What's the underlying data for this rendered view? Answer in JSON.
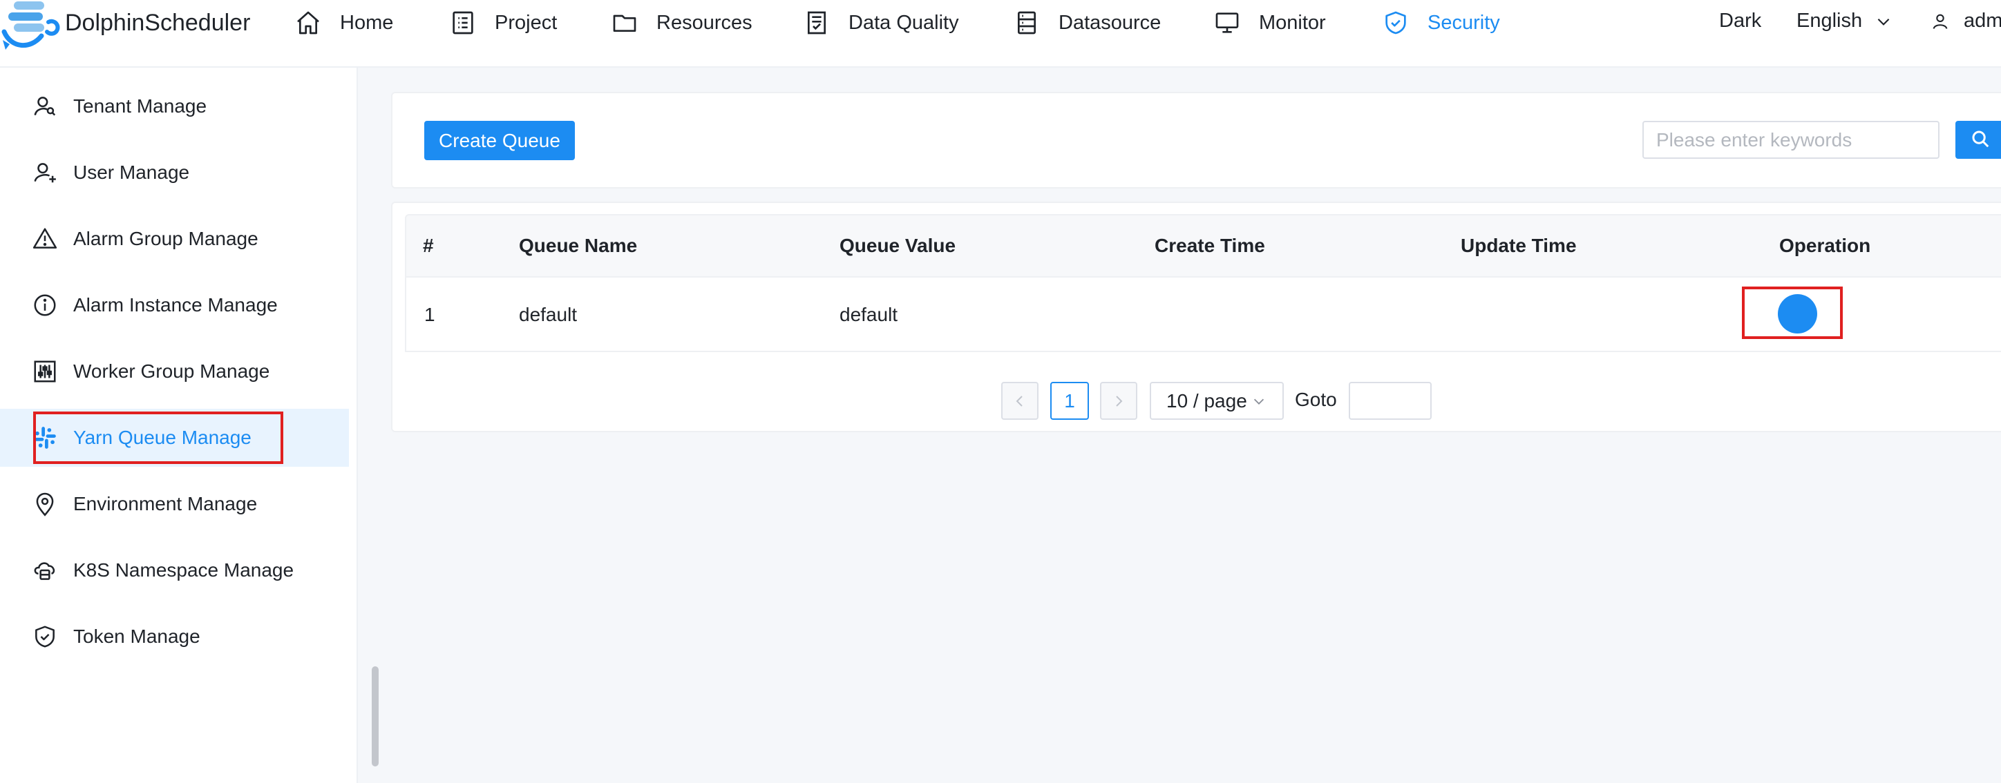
{
  "header": {
    "brand": "DolphinScheduler",
    "nav": [
      {
        "label": "Home",
        "icon": "home-icon"
      },
      {
        "label": "Project",
        "icon": "project-icon"
      },
      {
        "label": "Resources",
        "icon": "folder-icon"
      },
      {
        "label": "Data Quality",
        "icon": "data-quality-icon"
      },
      {
        "label": "Datasource",
        "icon": "datasource-icon"
      },
      {
        "label": "Monitor",
        "icon": "monitor-icon"
      },
      {
        "label": "Security",
        "icon": "shield-icon",
        "active": true
      }
    ],
    "theme_label": "Dark",
    "language_label": "English",
    "user_label": "adm"
  },
  "sidebar": {
    "items": [
      {
        "label": "Tenant Manage",
        "icon": "tenant-icon"
      },
      {
        "label": "User Manage",
        "icon": "user-add-icon"
      },
      {
        "label": "Alarm Group Manage",
        "icon": "warning-icon"
      },
      {
        "label": "Alarm Instance Manage",
        "icon": "info-icon"
      },
      {
        "label": "Worker Group Manage",
        "icon": "sliders-icon"
      },
      {
        "label": "Yarn Queue Manage",
        "icon": "slack-icon",
        "active": true
      },
      {
        "label": "Environment Manage",
        "icon": "location-icon"
      },
      {
        "label": "K8S Namespace Manage",
        "icon": "cloud-server-icon"
      },
      {
        "label": "Token Manage",
        "icon": "safety-icon"
      }
    ]
  },
  "toolbar": {
    "create_label": "Create Queue",
    "search_placeholder": "Please enter keywords",
    "search_value": ""
  },
  "table": {
    "columns": [
      "#",
      "Queue Name",
      "Queue Value",
      "Create Time",
      "Update Time",
      "Operation"
    ],
    "rows": [
      {
        "index": "1",
        "queue_name": "default",
        "queue_value": "default",
        "create_time": "",
        "update_time": ""
      }
    ]
  },
  "pagination": {
    "current_page": "1",
    "page_size_label": "10 / page",
    "goto_label": "Goto",
    "goto_value": ""
  },
  "colors": {
    "accent": "#1c8cf2",
    "highlight": "#e02020",
    "active_bg": "#e8f3fe"
  }
}
